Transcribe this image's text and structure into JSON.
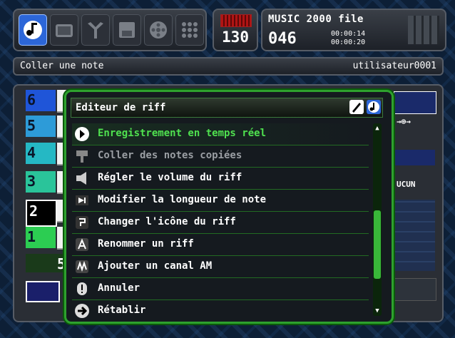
{
  "modes": [
    {
      "icon": "music-note-icon",
      "active": true
    },
    {
      "icon": "tv-icon",
      "active": false
    },
    {
      "icon": "mixer-icon",
      "active": false
    },
    {
      "icon": "disk-icon",
      "active": false
    },
    {
      "icon": "reel-icon",
      "active": false
    },
    {
      "icon": "grid-icon",
      "active": false
    }
  ],
  "tempo": {
    "value": "130"
  },
  "file": {
    "title": "MUSIC 2000 file",
    "counter": "046",
    "time_a": "00:00:14",
    "time_b": "00:00:20"
  },
  "status": {
    "message": "Coller une note",
    "user": "utilisateur0001"
  },
  "tracks": [
    {
      "num": "6",
      "color": "#1f55d8"
    },
    {
      "num": "5",
      "color": "#2d9bd8"
    },
    {
      "num": "4",
      "color": "#25b8c4"
    },
    {
      "num": "3",
      "color": "#2ac49a"
    },
    {
      "num": "2",
      "color": "#000000"
    },
    {
      "num": "1",
      "color": "#2ccd52"
    }
  ],
  "bottom_counter": "5",
  "right_labels": {
    "arrow": "→⊕→",
    "aucun": "UCUN"
  },
  "dialog": {
    "title": "Editeur de riff",
    "items": [
      {
        "label": "Enregistrement en temps réel",
        "icon": "play-arrow-icon",
        "state": "highlight"
      },
      {
        "label": "Coller des notes copiées",
        "icon": "paste-icon",
        "state": "disabled"
      },
      {
        "label": "Régler le volume du riff",
        "icon": "speaker-icon",
        "state": "normal"
      },
      {
        "label": "Modifier la longueur de note",
        "icon": "note-length-icon",
        "state": "normal"
      },
      {
        "label": "Changer l'icône du riff",
        "icon": "riff-icon-icon",
        "state": "normal"
      },
      {
        "label": "Renommer un riff",
        "icon": "letter-a-icon",
        "state": "normal"
      },
      {
        "label": "Ajouter un canal AM",
        "icon": "am-wave-icon",
        "state": "normal"
      },
      {
        "label": "Annuler",
        "icon": "exclamation-icon",
        "state": "normal"
      },
      {
        "label": "Rétablir",
        "icon": "redo-arrow-icon",
        "state": "normal"
      }
    ],
    "scroll_position": 0.74
  },
  "colors": {
    "accent": "#2ea12e",
    "highlight_text": "#4fe14f",
    "mode_active": "#2c66d8"
  }
}
